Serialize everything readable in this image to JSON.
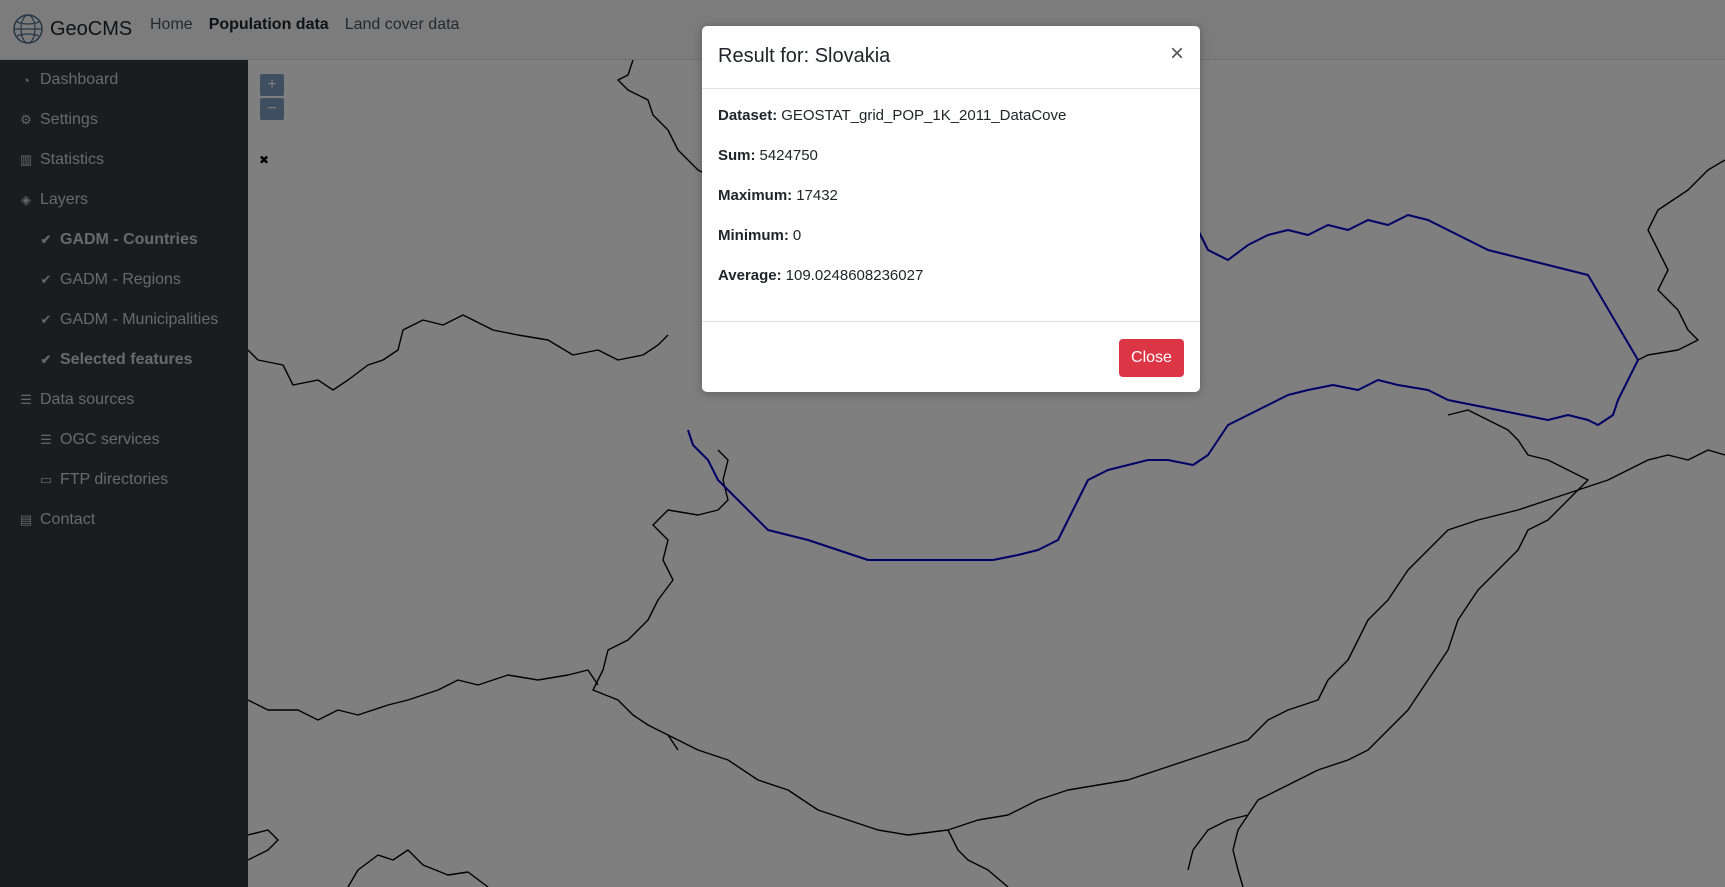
{
  "brand": {
    "name": "GeoCMS",
    "logo_icon": "globe-logo-icon"
  },
  "nav": {
    "items": [
      {
        "label": "Home",
        "active": false
      },
      {
        "label": "Population data",
        "active": true
      },
      {
        "label": "Land cover data",
        "active": false
      }
    ]
  },
  "sidebar": {
    "items": [
      {
        "label": "Dashboard",
        "icon": "tachometer-icon"
      },
      {
        "label": "Settings",
        "icon": "cogs-icon"
      },
      {
        "label": "Statistics",
        "icon": "chart-icon"
      },
      {
        "label": "Layers",
        "icon": "layers-icon"
      },
      {
        "label": "GADM - Countries",
        "icon": "check-double-icon"
      },
      {
        "label": "GADM - Regions",
        "icon": "check-icon"
      },
      {
        "label": "GADM - Municipalities",
        "icon": "check-icon"
      },
      {
        "label": "Selected features",
        "icon": "check-double-icon"
      },
      {
        "label": "Data sources",
        "icon": "database-icon"
      },
      {
        "label": "OGC services",
        "icon": "database-icon"
      },
      {
        "label": "FTP directories",
        "icon": "folder-open-icon"
      },
      {
        "label": "Contact",
        "icon": "address-card-icon"
      }
    ]
  },
  "map": {
    "zoom_in": "+",
    "zoom_out": "−",
    "select_button": "✖"
  },
  "modal": {
    "title": "Result for: Slovakia",
    "close_x": "×",
    "fields": [
      {
        "label": "Dataset:",
        "value": "GEOSTAT_grid_POP_1K_2011_DataCove"
      },
      {
        "label": "Sum:",
        "value": "5424750"
      },
      {
        "label": "Maximum:",
        "value": "17432"
      },
      {
        "label": "Minimum:",
        "value": "0"
      },
      {
        "label": "Average:",
        "value": "109.0248608236027"
      }
    ],
    "close_button": "Close"
  },
  "colors": {
    "selected_border": "#0000cc",
    "close_button": "#dc3545",
    "sidebar": "#343a40"
  }
}
